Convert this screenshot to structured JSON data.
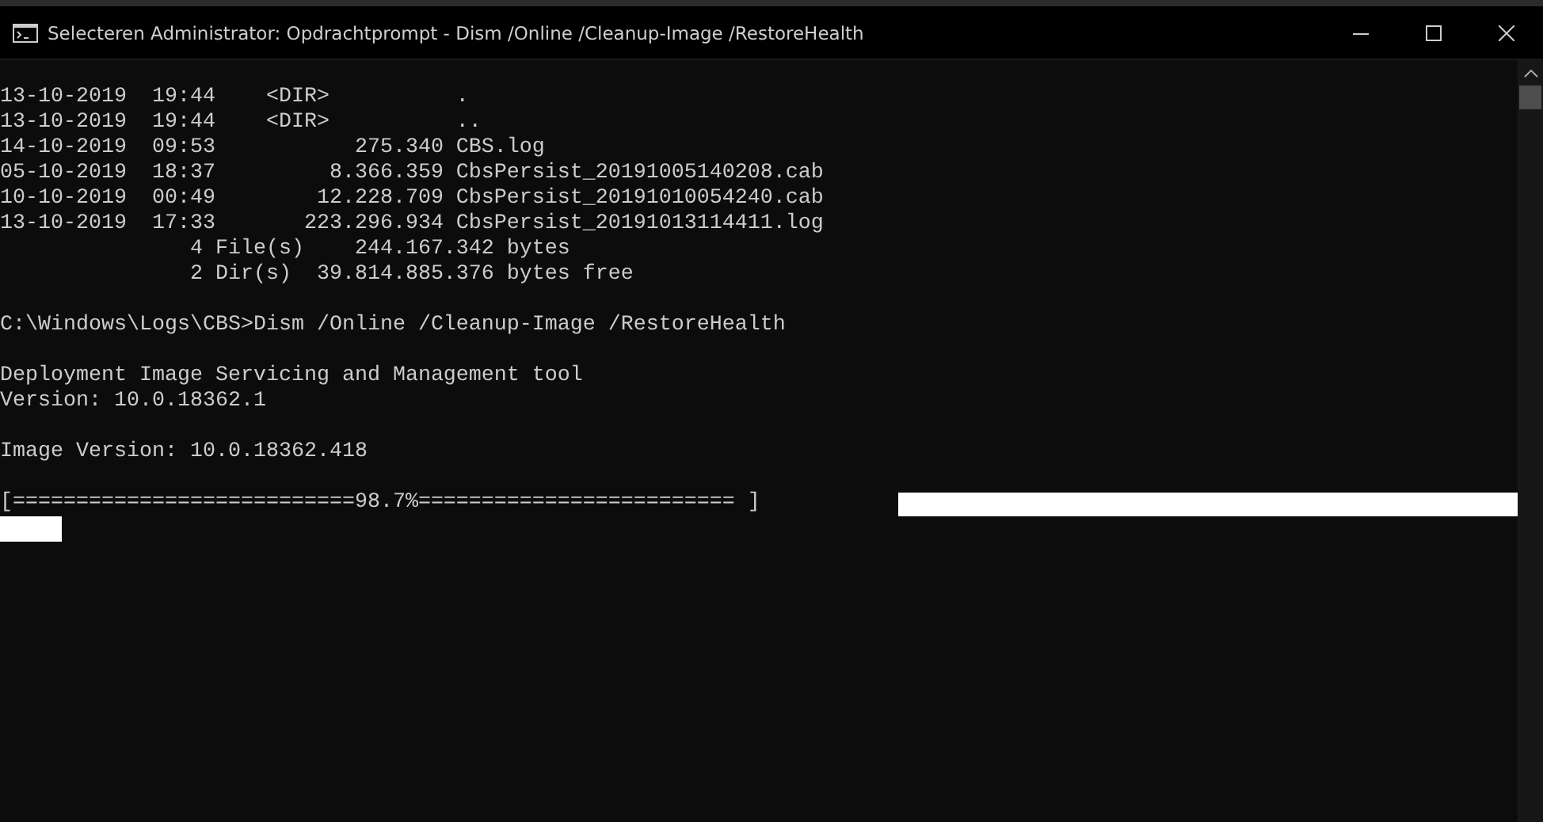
{
  "window": {
    "title": "Selecteren Administrator: Opdrachtprompt - Dism  /Online /Cleanup-Image /RestoreHealth"
  },
  "console": {
    "blocks": [
      [
        "13-10-2019  19:44    <DIR>          .",
        "13-10-2019  19:44    <DIR>          ..",
        "14-10-2019  09:53           275.340 CBS.log",
        "05-10-2019  18:37         8.366.359 CbsPersist_20191005140208.cab",
        "10-10-2019  00:49        12.228.709 CbsPersist_20191010054240.cab",
        "13-10-2019  17:33       223.296.934 CbsPersist_20191013114411.log",
        "               4 File(s)    244.167.342 bytes",
        "               2 Dir(s)  39.814.885.376 bytes free"
      ],
      [
        "C:\\Windows\\Logs\\CBS>Dism /Online /Cleanup-Image /RestoreHealth"
      ],
      [
        "Deployment Image Servicing and Management tool",
        "Version: 10.0.18362.1"
      ],
      [
        "Image Version: 10.0.18362.418"
      ]
    ],
    "progress": "[===========================98.7%========================= ]"
  }
}
